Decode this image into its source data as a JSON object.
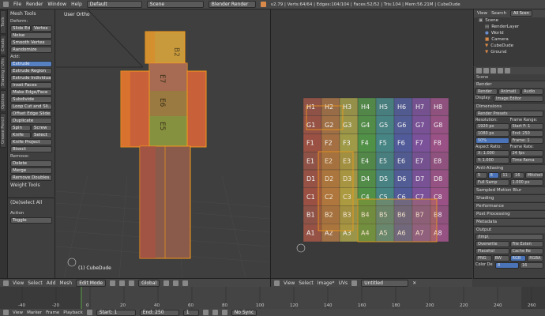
{
  "topbar": {
    "menus": [
      "File",
      "Render",
      "Window",
      "Help"
    ],
    "layout": "Default",
    "scene": "Scene",
    "engine": "Blender Render",
    "stats": "v2.79 | Verts:64/64 | Edges:104/104 | Faces:52/52 | Tris:104 | Mem:56.21M | CubeDude"
  },
  "lefttabs": [
    "Tools",
    "Create",
    "Shading / UVs",
    "Options",
    "Grease Pencil"
  ],
  "toolshelf": {
    "title": "Mesh Tools",
    "deform_label": "Deform:",
    "deform": [
      "Slide Ed",
      "Vertex",
      "Noise",
      "Smooth Vertex",
      "Randomize"
    ],
    "add_label": "Add:",
    "add": [
      "Extrude",
      "Extrude Region",
      "Extrude Individual",
      "Inset Faces",
      "Make Edge/Face",
      "Subdivide",
      "Loop Cut and Sli...",
      "Offset Edge Slide",
      "Duplicate"
    ],
    "spin": "Spin",
    "screw": "Screw",
    "knife": "Knife",
    "select": "Select",
    "knife_project": "Knife Project",
    "bisect": "Bisect",
    "remove_label": "Remove:",
    "delete": "Delete",
    "merge": "Merge",
    "remove_doubles": "Remove Doubles",
    "weight_tools": "Weight Tools"
  },
  "opshelf": {
    "title": "(De)select All",
    "action_label": "Action",
    "action": "Toggle"
  },
  "viewport": {
    "label": "User Ortho",
    "object": "(1) CubeDude",
    "labels": [
      "B2",
      "E7",
      "E6",
      "E5"
    ]
  },
  "viewport_header": {
    "items": [
      "View",
      "Select",
      "Add",
      "Mesh"
    ],
    "mode": "Edit Mode",
    "pivot": "Global"
  },
  "uv_grid": {
    "rows": [
      "H",
      "G",
      "F",
      "E",
      "D",
      "C",
      "B",
      "A"
    ],
    "cols": [
      "1",
      "2",
      "3",
      "4",
      "5",
      "6",
      "7",
      "8"
    ]
  },
  "uv_header": {
    "items": [
      "View",
      "Select",
      "Image*",
      "UVs"
    ],
    "image": "Untitled"
  },
  "outliner": {
    "view": "View",
    "search": "Search",
    "all": "All Scen",
    "items": [
      "Scene",
      "RenderLayer",
      "World",
      "Camera",
      "CubeDude",
      "Ground"
    ]
  },
  "props": {
    "scene": "Scene",
    "render": "Render",
    "render_btn": "Render",
    "anim_btn": "Animati",
    "audio_btn": "Audio",
    "display_label": "Display:",
    "display": "Image Editor",
    "dimensions": "Dimensions",
    "presets": "Render Presets",
    "resolution": "Resolution:",
    "res_x": "1920 px",
    "res_y": "1080 px",
    "res_pct": "50%",
    "frame_range": "Frame Range:",
    "start": "Start F: 1",
    "end": "End: 250",
    "frame": "Frame: 1",
    "aspect": "Aspect Ratio:",
    "ax": "X: 1.000",
    "ay": "Y: 1.000",
    "frame_rate": "Frame Rate:",
    "fps": "24 fps",
    "time_remap": "Time Rema",
    "aa": "Anti-Aliasing",
    "aa_5": "5",
    "aa_8": "8",
    "aa_11": "11",
    "aa_16": "16",
    "filter": "Mitchell-",
    "full_sample": "Full Samp",
    "full_val": "1.000 px",
    "motion_blur": "Sampled Motion Blur",
    "shading": "Shading",
    "performance": "Performance",
    "post": "Post Processing",
    "metadata": "Metadata",
    "output": "Output",
    "path": "/tmp\\",
    "overwrite": "Overwrite",
    "file_ext": "File Exten",
    "placeholders": "Placehol",
    "cache": "Cache Re",
    "format": "PNG",
    "bw": "BW",
    "rgb": "RGB",
    "rgba": "RGBA",
    "color_depth": "Color De",
    "cd_8": "8",
    "cd_16": "16"
  },
  "timeline": {
    "items": [
      "View",
      "Marker",
      "Frame",
      "Playback"
    ],
    "start": "Start:",
    "start_val": "1",
    "end": "End:",
    "end_val": "250",
    "current": "1",
    "sync": "No Sync",
    "ticks": [
      "-40",
      "-20",
      "0",
      "20",
      "40",
      "60",
      "80",
      "100",
      "120",
      "140",
      "160",
      "180",
      "200",
      "220",
      "240",
      "260"
    ]
  }
}
